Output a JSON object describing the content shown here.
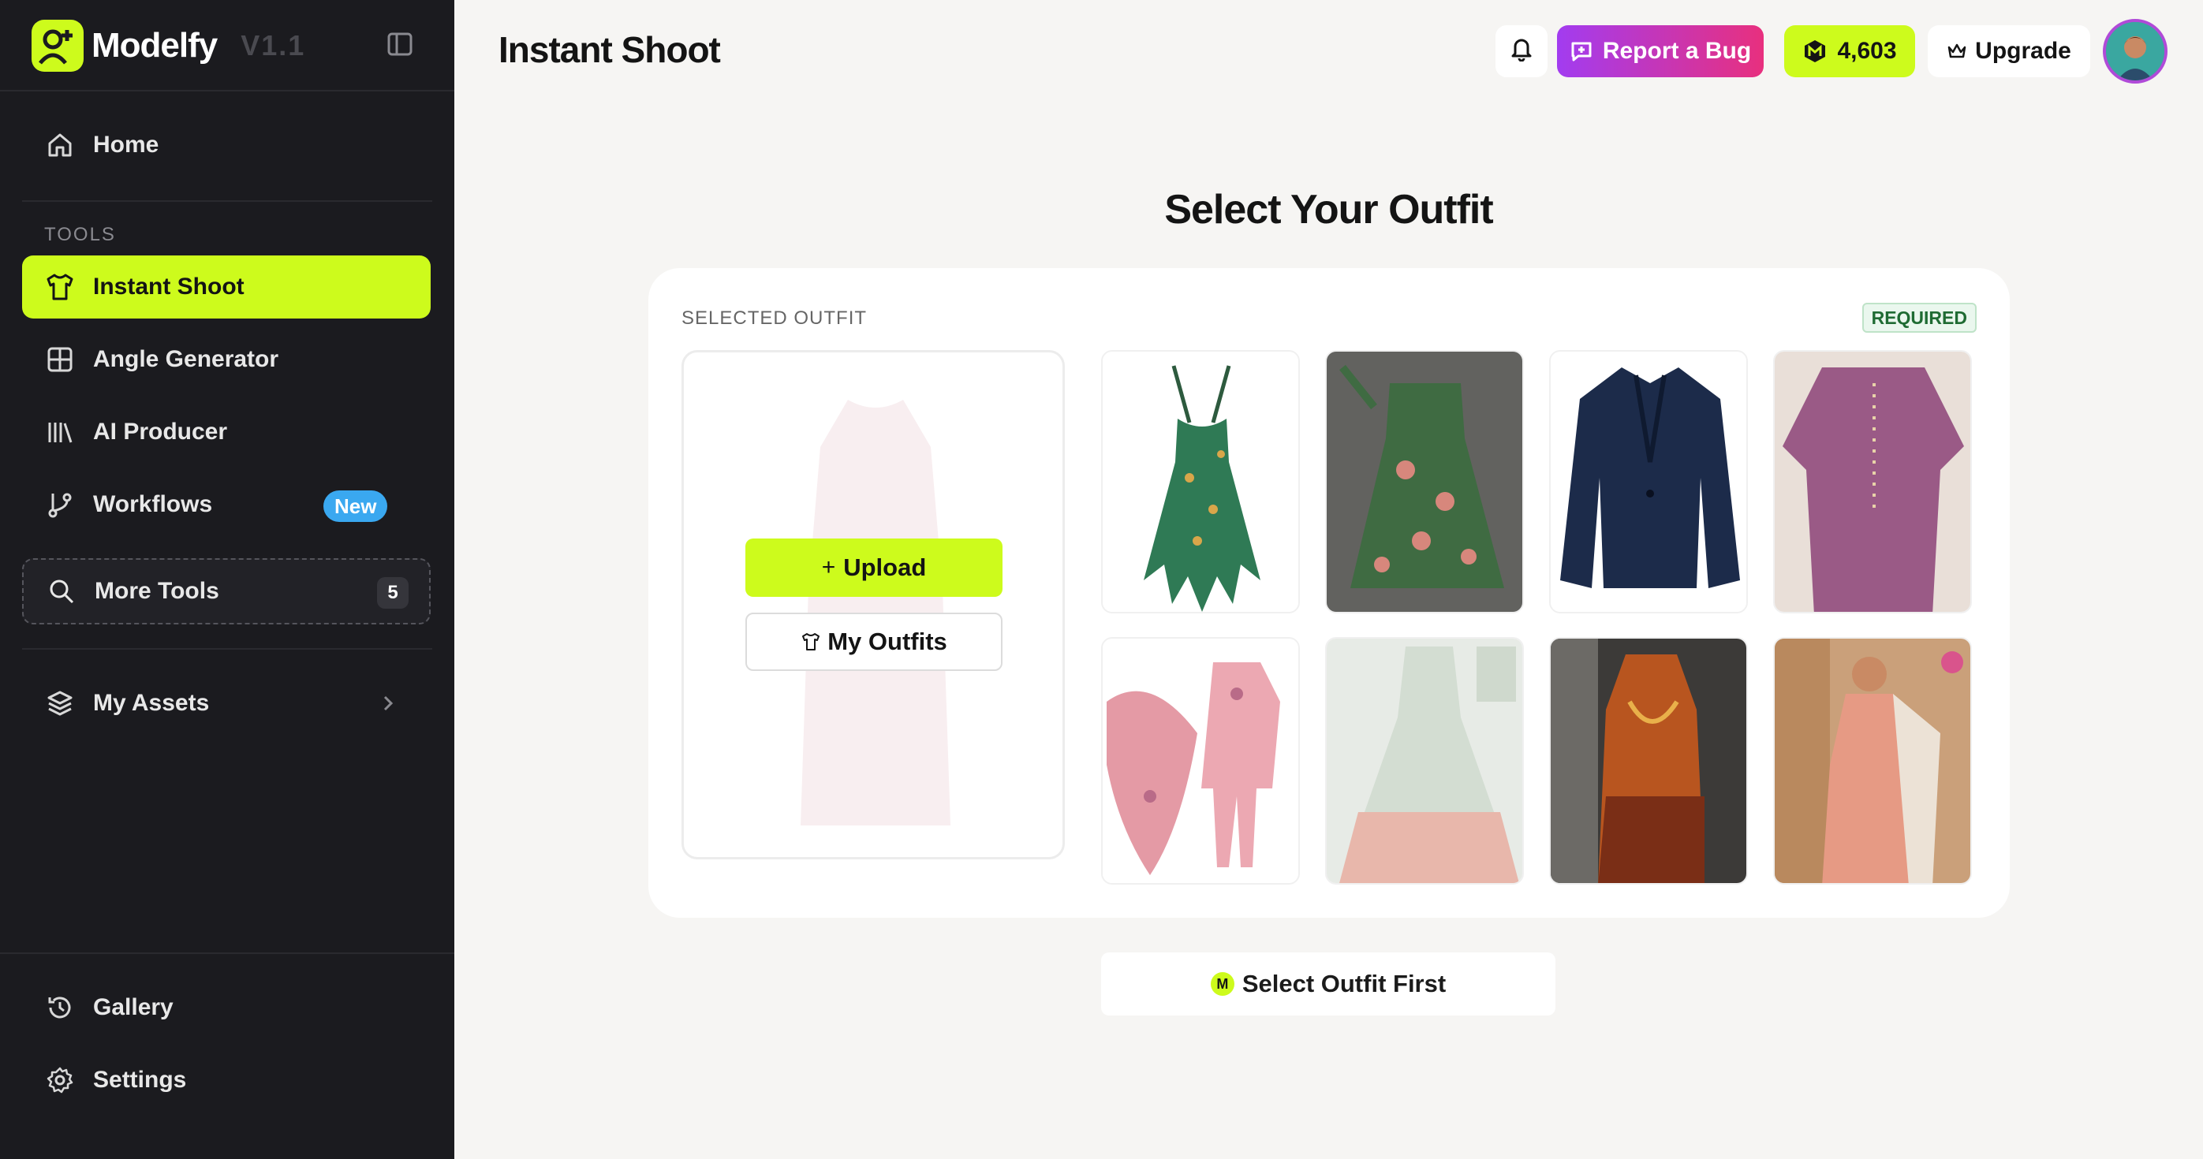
{
  "brand": {
    "name": "Modelfy",
    "version": "V1.1"
  },
  "sidebar": {
    "home_label": "Home",
    "tools_section": "TOOLS",
    "items": [
      {
        "label": "Instant Shoot",
        "icon": "shirt-icon",
        "active": true
      },
      {
        "label": "Angle Generator",
        "icon": "grid-icon"
      },
      {
        "label": "AI Producer",
        "icon": "library-icon"
      },
      {
        "label": "Workflows",
        "icon": "branch-icon",
        "badge": "New"
      }
    ],
    "more_tools": {
      "label": "More Tools",
      "count": "5"
    },
    "my_assets": "My Assets",
    "gallery": "Gallery",
    "settings": "Settings"
  },
  "header": {
    "title": "Instant Shoot",
    "report_bug": "Report a Bug",
    "credits": "4,603",
    "upgrade": "Upgrade"
  },
  "main": {
    "heading": "Select Your Outfit",
    "selected_outfit_label": "SELECTED OUTFIT",
    "required_badge": "REQUIRED",
    "upload_label": "Upload",
    "my_outfits_label": "My Outfits",
    "cta_label": "Select Outfit First",
    "outfits": [
      "green-floral-handkerchief-dress",
      "green-floral-sundress",
      "navy-blazer",
      "mauve-kurta",
      "pink-embroidered-suit",
      "mint-pink-anarkali",
      "orange-printed-suit",
      "peach-kurta-with-dupatta"
    ]
  },
  "colors": {
    "accent": "#cdfb1c",
    "sidebar_bg": "#1b1b1f",
    "page_bg": "#f6f5f3",
    "bug_gradient_start": "#a23cf0",
    "bug_gradient_end": "#e8307e",
    "new_badge": "#3aa8f0"
  }
}
